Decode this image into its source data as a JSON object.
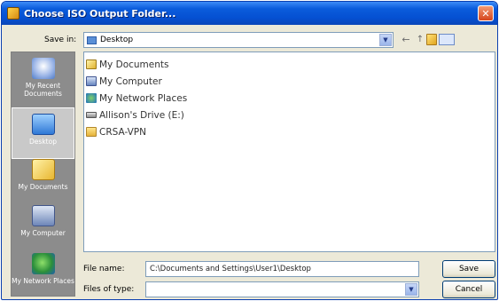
{
  "dialog": {
    "title": "Choose ISO Output Folder...",
    "close_glyph": "✕"
  },
  "toolbar": {
    "save_in_label": "Save in:",
    "save_in_value": "Desktop",
    "dropdown_glyph": "▼",
    "back_glyph": "←",
    "up_glyph": "↑"
  },
  "places": [
    {
      "label": "My Recent Documents",
      "icon": "recent-documents-icon"
    },
    {
      "label": "Desktop",
      "icon": "desktop-icon",
      "active": true
    },
    {
      "label": "My Documents",
      "icon": "my-documents-icon"
    },
    {
      "label": "My Computer",
      "icon": "my-computer-icon"
    },
    {
      "label": "My Network Places",
      "icon": "network-places-icon"
    }
  ],
  "files": [
    {
      "label": "My Documents",
      "icon": "my-documents-icon"
    },
    {
      "label": "My Computer",
      "icon": "my-computer-icon"
    },
    {
      "label": "My Network Places",
      "icon": "network-places-icon"
    },
    {
      "label": "Allison's Drive (E:)",
      "icon": "drive-icon"
    },
    {
      "label": "CRSA-VPN",
      "icon": "folder-icon"
    }
  ],
  "footer": {
    "file_name_label": "File name:",
    "file_name_value": "C:\\Documents and Settings\\User1\\Desktop",
    "files_of_type_label": "Files of type:",
    "files_of_type_value": "",
    "save_label": "Save",
    "cancel_label": "Cancel"
  }
}
